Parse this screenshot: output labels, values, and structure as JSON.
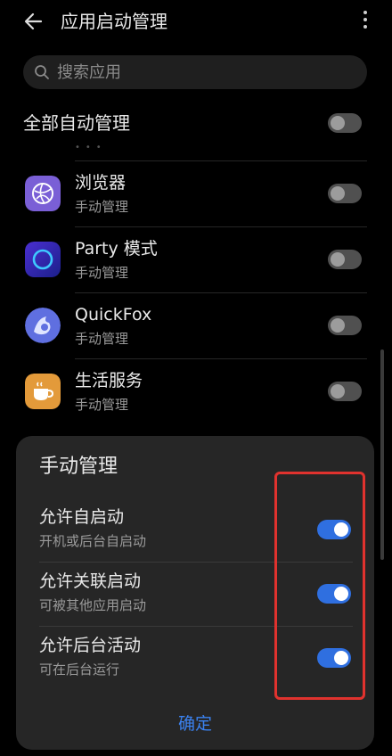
{
  "header": {
    "title": "应用启动管理"
  },
  "search": {
    "placeholder": "搜索应用"
  },
  "all_auto": {
    "label": "全部自动管理",
    "enabled": false
  },
  "apps": [
    {
      "name": "浏览器",
      "status": "手动管理",
      "icon": "browser-icon",
      "color": "#7a5fd6",
      "enabled": false
    },
    {
      "name": "Party 模式",
      "status": "手动管理",
      "icon": "party-mode-icon",
      "color": "#3a3fd0",
      "enabled": false
    },
    {
      "name": "QuickFox",
      "status": "手动管理",
      "icon": "quickfox-icon",
      "color": "#5f6fe0",
      "enabled": false
    },
    {
      "name": "生活服务",
      "status": "手动管理",
      "icon": "life-service-icon",
      "color": "#e39a3a",
      "enabled": false
    }
  ],
  "sheet": {
    "title": "手动管理",
    "rows": [
      {
        "label": "允许自启动",
        "sub": "开机或后台自启动",
        "enabled": true
      },
      {
        "label": "允许关联启动",
        "sub": "可被其他应用启动",
        "enabled": true
      },
      {
        "label": "允许后台活动",
        "sub": "可在后台运行",
        "enabled": true
      }
    ],
    "confirm_label": "确定"
  },
  "colors": {
    "accent": "#2f6fe0",
    "link": "#3b82f0",
    "highlight": "#e0322e"
  }
}
